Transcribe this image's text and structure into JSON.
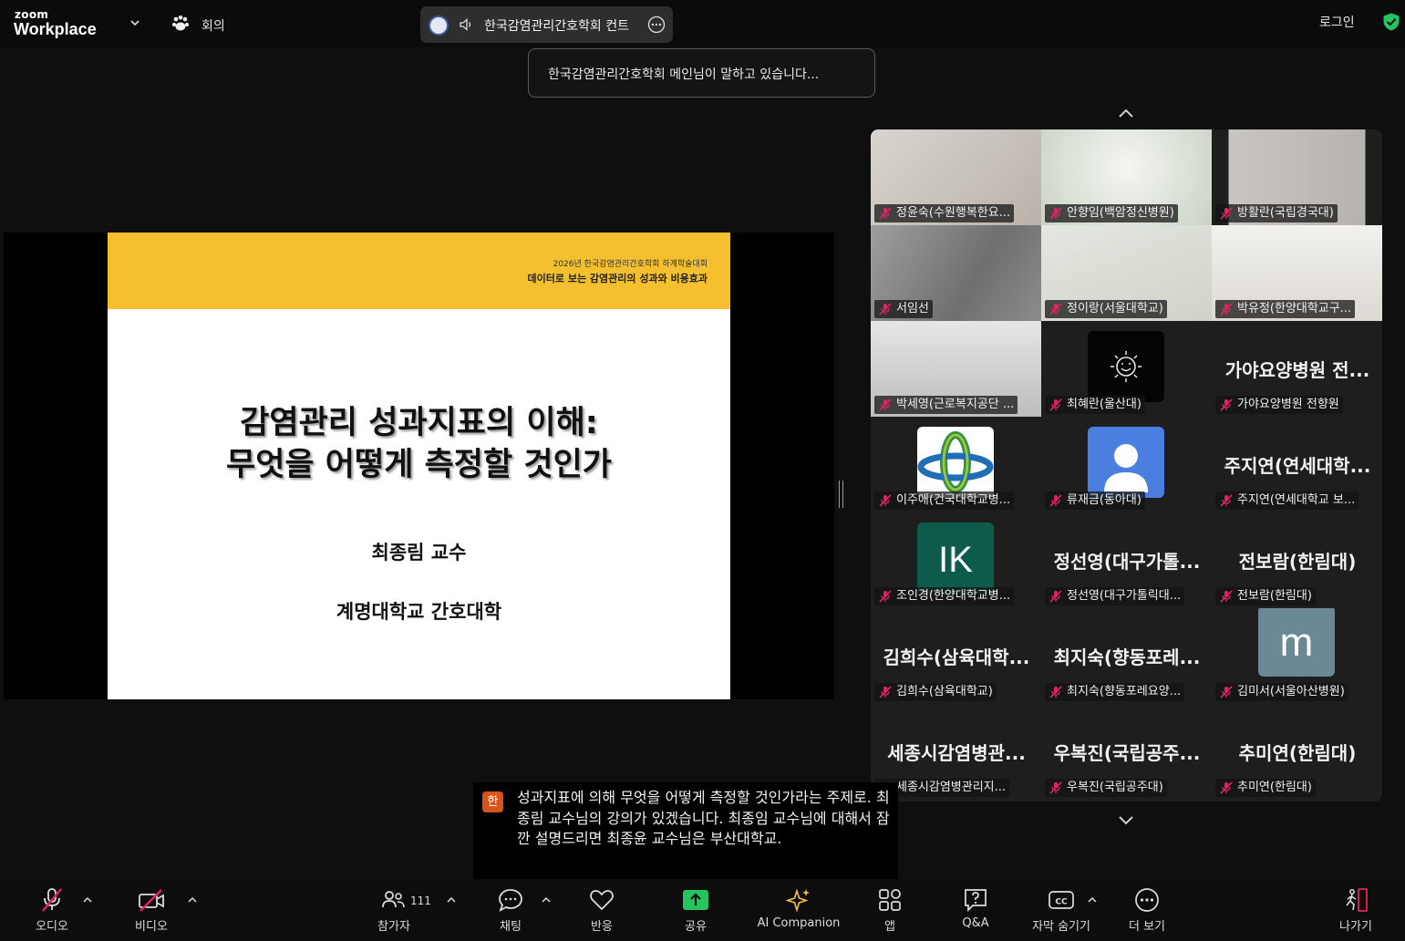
{
  "topbar": {
    "brand_small": "zoom",
    "brand_big": "Workplace",
    "meeting_label": "회의",
    "pill_title": "한국감염관리간호학회 컨트",
    "login": "로그인"
  },
  "speaking_banner": "한국감염관리간호학회 메인님이 말하고 있습니다...",
  "slide": {
    "conference": "2026년 한국감염관리간호학회 하계학술대회",
    "subtitle": "데이터로 보는 감염관리의 성과와 비용효과",
    "title_line1": "감염관리 성과지표의 이해:",
    "title_line2": "무엇을 어떻게 측정할 것인가",
    "presenter": "최종림 교수",
    "affiliation": "계명대학교 간호대학"
  },
  "gallery": {
    "tiles": [
      {
        "name": "정윤숙(수원행복한요..."
      },
      {
        "name": "안향임(백암정신병원)"
      },
      {
        "name": "방활란(국립경국대)"
      },
      {
        "name": "서임선"
      },
      {
        "name": "정이랑(서울대학교)"
      },
      {
        "name": "박유정(한양대학교구..."
      },
      {
        "name": "박세영(근로복지공단 ..."
      },
      {
        "name": "최혜란(울산대)"
      },
      {
        "name": "가야요양병원 전향원",
        "big": "가야요양병원 전..."
      },
      {
        "name": "이주애(건국대학교병..."
      },
      {
        "name": "류재금(동아대)"
      },
      {
        "name": "주지연(연세대학교 보...",
        "big": "주지연(연세대학..."
      },
      {
        "name": "조인경(한양대학교병...",
        "avatar_text": "IK"
      },
      {
        "name": "정선영(대구가톨릭대...",
        "big": "정선영(대구가톨..."
      },
      {
        "name": "전보람(한림대)",
        "big": "전보람(한림대)"
      },
      {
        "name": "김희수(삼육대학교)",
        "big": "김희수(삼육대학..."
      },
      {
        "name": "최지숙(향동포레요양...",
        "big": "최지숙(향동포레..."
      },
      {
        "name": "김미서(서울아산병원)",
        "avatar_text": "m"
      },
      {
        "name": "세종시감염병관리지...",
        "big": "세종시감염병관..."
      },
      {
        "name": "우복진(국립공주대)",
        "big": "우복진(국립공주..."
      },
      {
        "name": "추미연(한림대)",
        "big": "추미연(한림대)"
      }
    ]
  },
  "caption": {
    "badge": "한",
    "text": "성과지표에 의해 무엇을 어떻게 측정할 것인가라는 주제로. 최종림 교수님의 강의가 있겠습니다. 최종임 교수님에 대해서 잠깐 설명드리면 최종윤 교수님은 부산대학교."
  },
  "toolbar": {
    "audio": "오디오",
    "video": "비디오",
    "participants": "참가자",
    "participants_count": "111",
    "chat": "채팅",
    "reactions": "반응",
    "share": "공유",
    "ai": "AI Companion",
    "apps": "앱",
    "qa": "Q&A",
    "captions": "자막 숨기기",
    "more": "더 보기",
    "leave": "나가기"
  },
  "colors": {
    "share_green": "#22c55e",
    "leave_red": "#e0245e",
    "ai_gold": "#f5c542",
    "muted_red": "#e0245e",
    "slide_band": "#f5c030"
  }
}
